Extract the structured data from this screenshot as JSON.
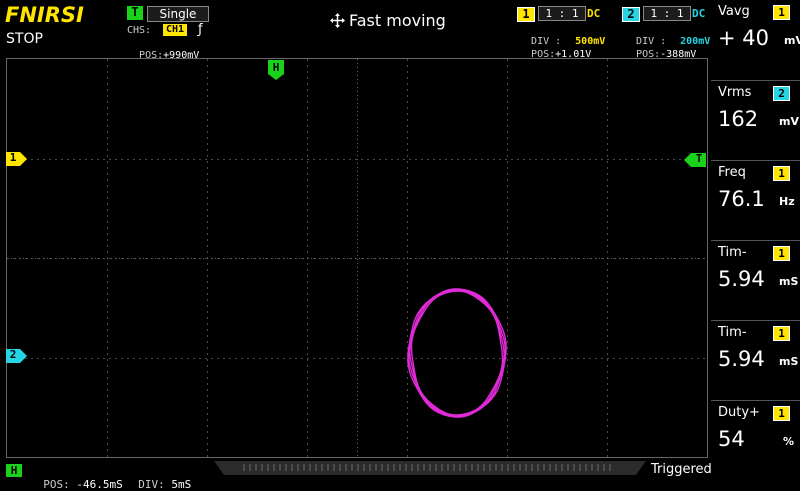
{
  "colors": {
    "ch1": "#ffe500",
    "ch2": "#26d5e4",
    "trigger": "#1ad21a",
    "trace": "#e02ad8"
  },
  "header": {
    "brand": "FNIRSI",
    "run_state": "STOP",
    "trigger": {
      "badge": "T",
      "mode": "Single",
      "chs_label": "CHS:",
      "chs_value": "CH1",
      "edge_icon": "rising-edge-icon",
      "edge_glyph": "ƒ",
      "pos_label": "POS:",
      "pos_value": "+990mV"
    },
    "mode_text": "Fast moving",
    "mode_icon": "move-arrows-icon",
    "ch1": {
      "num": "1",
      "ratio": "1 : 1",
      "coupling": "DC",
      "div_label": "DIV :",
      "div_value": "500mV",
      "pos_label": "POS:",
      "pos_value": "+1.01V"
    },
    "ch2": {
      "num": "2",
      "ratio": "1 : 1",
      "coupling": "DC",
      "div_label": "DIV :",
      "div_value": "200mV",
      "pos_label": "POS:",
      "pos_value": "-388mV"
    }
  },
  "markers": {
    "h": "H",
    "ch1": "1",
    "ch2": "2",
    "trigger": "T"
  },
  "footer": {
    "h_badge": "H",
    "pos_label": "POS:",
    "pos_value": "-46.5mS",
    "div_label": "DIV:",
    "div_value": "5mS",
    "status": "Triggered"
  },
  "measurements": [
    {
      "name": "Vavg",
      "ch": "1",
      "value": "+ 40",
      "unit": "mV"
    },
    {
      "name": "Vrms",
      "ch": "2",
      "value": "162",
      "unit": "mV"
    },
    {
      "name": "Freq",
      "ch": "1",
      "value": "76.1",
      "unit": "Hz"
    },
    {
      "name": "Tim-",
      "ch": "1",
      "value": "5.94",
      "unit": "mS"
    },
    {
      "name": "Tim-",
      "ch": "1",
      "value": "5.94",
      "unit": "mS"
    },
    {
      "name": "Duty+",
      "ch": "1",
      "value": "54",
      "unit": "%"
    }
  ]
}
